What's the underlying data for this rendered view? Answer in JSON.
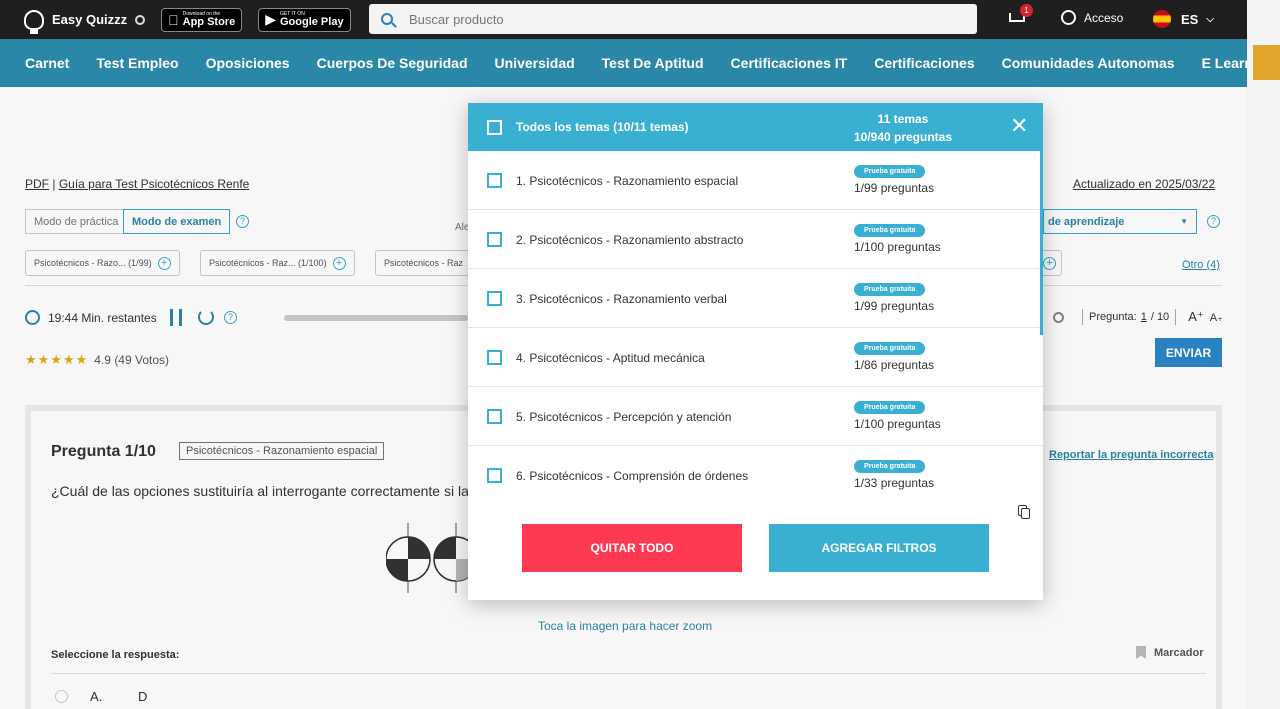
{
  "header": {
    "brand": "Easy Quizzz",
    "app_store": {
      "small": "Download on the",
      "big": "App Store"
    },
    "google_play": {
      "small": "GET IT ON",
      "big": "Google Play"
    },
    "search_placeholder": "Buscar producto",
    "cart_count": "1",
    "login": "Acceso",
    "language": "ES"
  },
  "nav": [
    "Carnet",
    "Test Empleo",
    "Oposiciones",
    "Cuerpos De Seguridad",
    "Universidad",
    "Test De Aptitud",
    "Certificaciones IT",
    "Certificaciones",
    "Comunidades Autonomas",
    "E Learning"
  ],
  "breadcrumb": {
    "pdf": "PDF",
    "sep": "|",
    "guide": "Guía para Test Psicotécnicos Renfe"
  },
  "updated": "Actualizado en 2025/03/22",
  "modes": {
    "practice": "Modo de práctica",
    "exam": "Modo de examen"
  },
  "ale_text": "Ale",
  "learning_select": "de aprendizaje",
  "chips": [
    {
      "label": "Psicotécnicos - Razo...",
      "count": "(1/99)"
    },
    {
      "label": "Psicotécnicos - Raz...",
      "count": "(1/100)"
    },
    {
      "label": "Psicotécnicos - Raz",
      "count": ""
    }
  ],
  "otro": "Otro (4)",
  "timer": "19:44 Min. restantes",
  "pregunta_nav": {
    "label": "Pregunta:",
    "current": "1",
    "total": "/ 10",
    "font_up": "A⁺",
    "font_down": "A₊"
  },
  "rating": {
    "stars": "★★★★★",
    "score": "4.9",
    "votes": "(49 Votos)"
  },
  "submit": "ENVIAR",
  "question": {
    "title": "Pregunta 1/10",
    "tag": "Psicotécnicos - Razonamiento espacial",
    "report": "Reportar la pregunta incorrecta",
    "text": "¿Cuál de las opciones sustituiría al interrogante correctamente si la",
    "zoom_hint": "Toca la imagen para hacer zoom",
    "select_label": "Seleccione la respuesta:",
    "bookmark": "Marcador",
    "option": {
      "letter": "A.",
      "value": "D"
    }
  },
  "modal": {
    "all_label": "Todos los temas (10/11 temas)",
    "summary_topics": "11 temas",
    "summary_questions": "10/940 preguntas",
    "close": "✕",
    "topics": [
      {
        "name": "1. Psicotécnicos - Razonamiento espacial",
        "badge": "Prueba gratuita",
        "count": "1/99 preguntas"
      },
      {
        "name": "2. Psicotécnicos - Razonamiento abstracto",
        "badge": "Prueba gratuita",
        "count": "1/100 preguntas"
      },
      {
        "name": "3. Psicotécnicos - Razonamiento verbal",
        "badge": "Prueba gratuita",
        "count": "1/99 preguntas"
      },
      {
        "name": "4. Psicotécnicos - Aptitud mecánica",
        "badge": "Prueba gratuita",
        "count": "1/86 preguntas"
      },
      {
        "name": "5. Psicotécnicos - Percepción y atención",
        "badge": "Prueba gratuita",
        "count": "1/100 preguntas"
      },
      {
        "name": "6. Psicotécnicos - Comprensión de órdenes",
        "badge": "Prueba gratuita",
        "count": "1/33 preguntas"
      }
    ],
    "remove_all": "QUITAR TODO",
    "add_filters": "AGREGAR FILTROS"
  },
  "colors": {
    "nav": "#2b87a7",
    "modal_header": "#39afd1",
    "danger": "#fe3a52",
    "accent": "#e0a52a"
  }
}
